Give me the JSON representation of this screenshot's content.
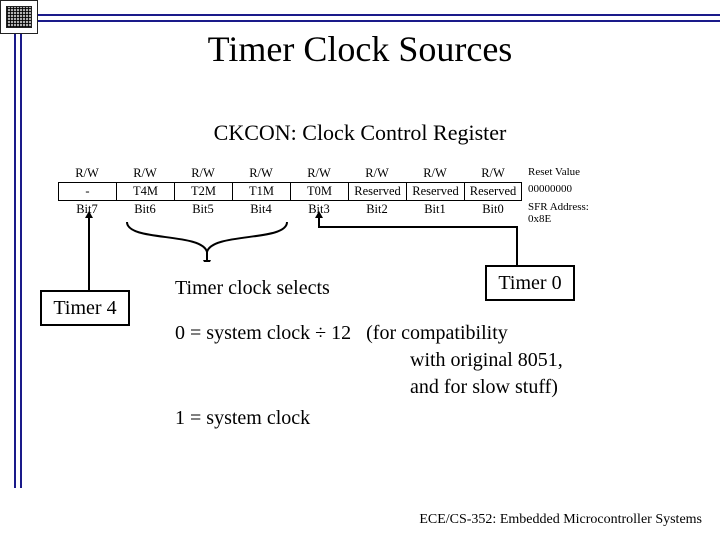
{
  "title": "Timer Clock Sources",
  "subtitle": "CKCON: Clock Control Register",
  "register": {
    "rw_row": [
      "R/W",
      "R/W",
      "R/W",
      "R/W",
      "R/W",
      "R/W",
      "R/W",
      "R/W"
    ],
    "name_row": [
      "-",
      "T4M",
      "T2M",
      "T1M",
      "T0M",
      "Reserved",
      "Reserved",
      "Reserved"
    ],
    "bit_row": [
      "Bit7",
      "Bit6",
      "Bit5",
      "Bit4",
      "Bit3",
      "Bit2",
      "Bit1",
      "Bit0"
    ],
    "reset_label": "Reset Value",
    "reset_value": "00000000",
    "addr_label": "SFR Address:",
    "addr_value": "0x8E"
  },
  "labels": {
    "timer4": "Timer 4",
    "timer0": "Timer 0",
    "clock_selects": "Timer clock selects",
    "mode0": "0 = system clock ÷ 12   (for compatibility",
    "mode0b": "with original 8051,",
    "mode0c": "and for slow stuff)",
    "mode1": "1 = system clock"
  },
  "footer": "ECE/CS-352: Embedded Microcontroller Systems"
}
